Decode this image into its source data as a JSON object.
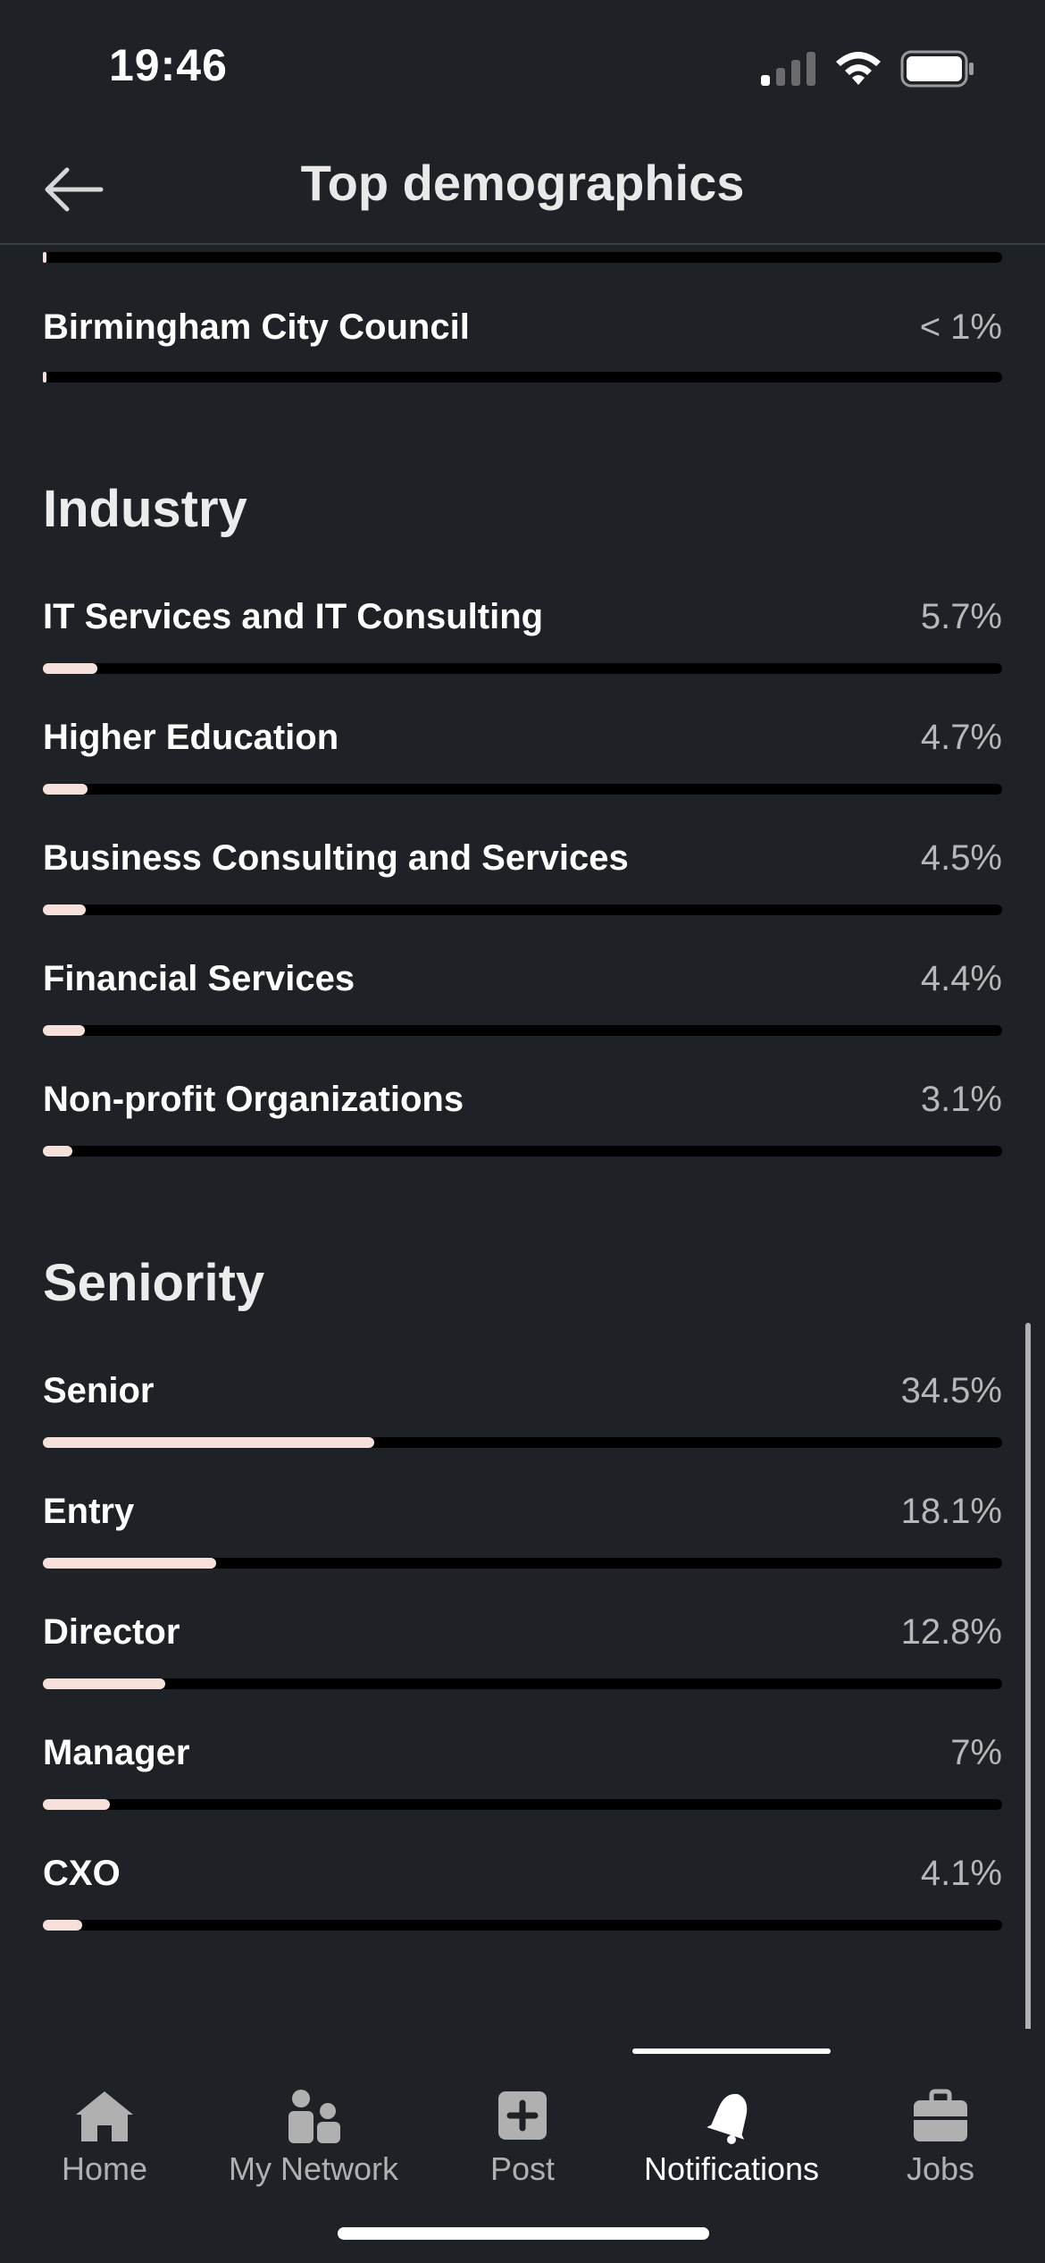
{
  "status_bar": {
    "time": "19:46"
  },
  "header": {
    "title": "Top demographics"
  },
  "location": {
    "items": [
      {
        "label": "Birmingham City Council",
        "value": "< 1%",
        "fraction": 0.003
      }
    ]
  },
  "industry": {
    "title": "Industry",
    "items": [
      {
        "label": "IT Services and IT Consulting",
        "value": "5.7%",
        "fraction": 0.057
      },
      {
        "label": "Higher Education",
        "value": "4.7%",
        "fraction": 0.047
      },
      {
        "label": "Business Consulting and Services",
        "value": "4.5%",
        "fraction": 0.045
      },
      {
        "label": "Financial Services",
        "value": "4.4%",
        "fraction": 0.044
      },
      {
        "label": "Non-profit Organizations",
        "value": "3.1%",
        "fraction": 0.031
      }
    ]
  },
  "seniority": {
    "title": "Seniority",
    "items": [
      {
        "label": "Senior",
        "value": "34.5%",
        "fraction": 0.345
      },
      {
        "label": "Entry",
        "value": "18.1%",
        "fraction": 0.181
      },
      {
        "label": "Director",
        "value": "12.8%",
        "fraction": 0.128
      },
      {
        "label": "Manager",
        "value": "7%",
        "fraction": 0.07
      },
      {
        "label": "CXO",
        "value": "4.1%",
        "fraction": 0.041
      }
    ]
  },
  "tab_bar": {
    "tabs": [
      {
        "label": "Home",
        "icon": "home-icon"
      },
      {
        "label": "My Network",
        "icon": "network-icon"
      },
      {
        "label": "Post",
        "icon": "post-icon"
      },
      {
        "label": "Notifications",
        "icon": "bell-icon",
        "active": true
      },
      {
        "label": "Jobs",
        "icon": "briefcase-icon"
      }
    ]
  },
  "colors": {
    "background": "#1e2226",
    "bar_fill": "#f6e0dc",
    "bar_track": "#000000"
  }
}
